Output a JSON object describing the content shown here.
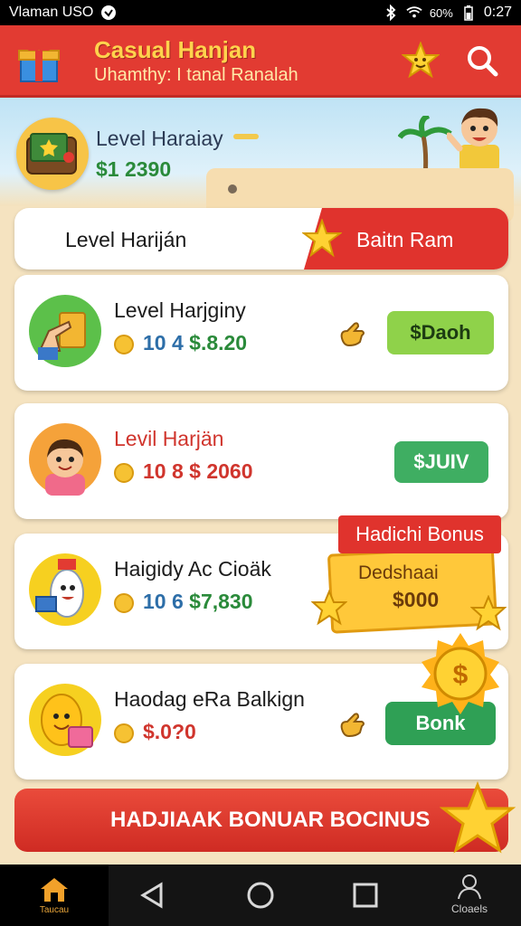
{
  "status_bar": {
    "carrier": "Vlaman USO",
    "battery": "60%",
    "time": "0:27"
  },
  "header": {
    "title": "Casual Hanjan",
    "subtitle": "Uhamthy: I tanal Ranalah"
  },
  "banner": {
    "level": "Level Haraiay",
    "amount": "$1 2390"
  },
  "tabs": {
    "left": "Level Hariján",
    "right": "Baitn Ram"
  },
  "cards": [
    {
      "name": "Level Harjginy",
      "count": "10 4",
      "money": "$.8.20",
      "button": "$Daoh",
      "button_color": "#8fd24a"
    },
    {
      "name": "Levil Harjän",
      "count": "10 8",
      "money": "$ 2060",
      "button": "$JUIV",
      "button_color": "#3fae62"
    },
    {
      "name": "Haigidy Ac Cioäk",
      "count": "10 6",
      "money": "$7,830"
    },
    {
      "name": "Haodag eRa Balkign",
      "count": "",
      "money": "$.0?0",
      "button": "Bonk",
      "button_color": "#2fa055"
    }
  ],
  "bonus_badge": {
    "title": "Hadichi Bonus",
    "line1": "Dedshaai",
    "line2": "$000"
  },
  "bonus_bar": {
    "label": "HADJIAAK BONUAR BOCINUS"
  },
  "nav": {
    "home_label": "Taucau",
    "profile_label": "Cloaels"
  },
  "colors": {
    "header_red": "#e23b32",
    "accent_yellow": "#ffd34d",
    "money_green": "#2a8a3a"
  }
}
